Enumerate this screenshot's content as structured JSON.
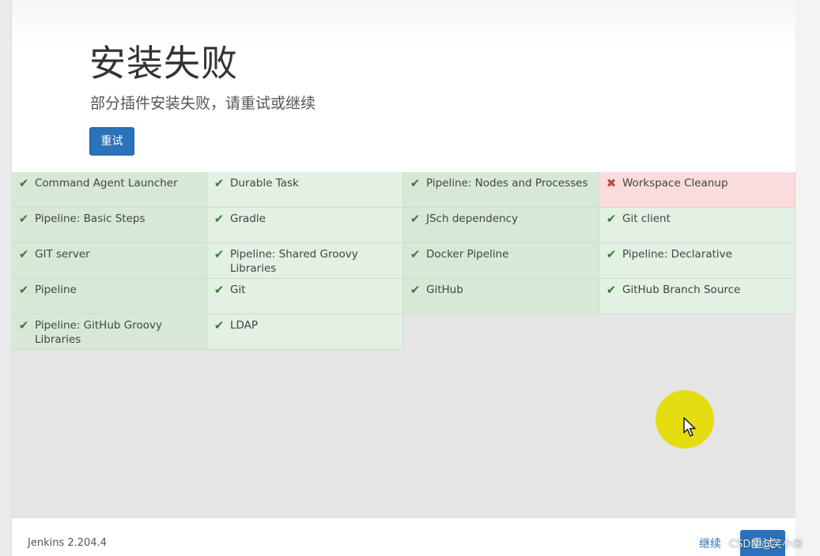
{
  "header": {
    "title": "安装失败",
    "subtitle": "部分插件安装失败，请重试或继续",
    "retry_label": "重试"
  },
  "colors": {
    "success": "#e2f1e2",
    "success_alt": "#d7e9d6",
    "failed": "#fbdcdc",
    "check": "#3b7a39",
    "cross": "#b84a4a",
    "button": "#2a72b9"
  },
  "plugins": [
    {
      "name": "Command Agent Launcher",
      "status": "success",
      "icon": "check-icon"
    },
    {
      "name": "Durable Task",
      "status": "success",
      "icon": "check-icon"
    },
    {
      "name": "Pipeline: Nodes and Processes",
      "status": "success",
      "icon": "check-icon"
    },
    {
      "name": "Workspace Cleanup",
      "status": "failed",
      "icon": "cross-icon"
    },
    {
      "name": "Pipeline: Basic Steps",
      "status": "success",
      "icon": "check-icon"
    },
    {
      "name": "Gradle",
      "status": "success",
      "icon": "check-icon"
    },
    {
      "name": "JSch dependency",
      "status": "success",
      "icon": "check-icon"
    },
    {
      "name": "Git client",
      "status": "success",
      "icon": "check-icon"
    },
    {
      "name": "GIT server",
      "status": "success",
      "icon": "check-icon"
    },
    {
      "name": "Pipeline: Shared Groovy Libraries",
      "status": "success",
      "icon": "check-icon"
    },
    {
      "name": "Docker Pipeline",
      "status": "success",
      "icon": "check-icon"
    },
    {
      "name": "Pipeline: Declarative",
      "status": "success",
      "icon": "check-icon"
    },
    {
      "name": "Pipeline",
      "status": "success",
      "icon": "check-icon"
    },
    {
      "name": "Git",
      "status": "success",
      "icon": "check-icon"
    },
    {
      "name": "GitHub",
      "status": "success",
      "icon": "check-icon"
    },
    {
      "name": "GitHub Branch Source",
      "status": "success",
      "icon": "check-icon"
    },
    {
      "name": "Pipeline: GitHub Groovy Libraries",
      "status": "success",
      "icon": "check-icon"
    },
    {
      "name": "LDAP",
      "status": "success",
      "icon": "check-icon"
    }
  ],
  "footer": {
    "version": "Jenkins 2.204.4",
    "continue_label": "继续",
    "retry_label": "重试"
  },
  "watermark": "CSDN @笑小米"
}
